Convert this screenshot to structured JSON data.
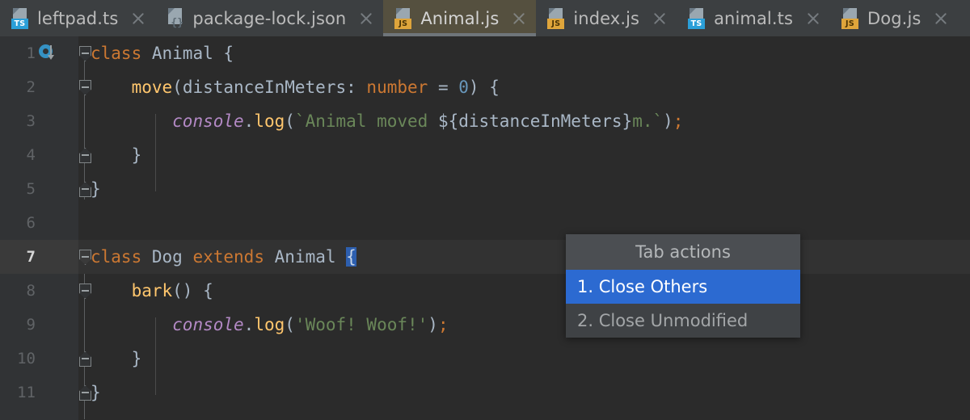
{
  "tabs": [
    {
      "label": "leftpad.ts",
      "icon": "typescript-file-icon",
      "badge": "TS",
      "kind": "ts",
      "active": false
    },
    {
      "label": "package-lock.json",
      "icon": "json-file-icon",
      "badge": "{}",
      "kind": "json",
      "active": false
    },
    {
      "label": "Animal.js",
      "icon": "javascript-file-icon",
      "badge": "JS",
      "kind": "js",
      "active": true
    },
    {
      "label": "index.js",
      "icon": "javascript-file-icon",
      "badge": "JS",
      "kind": "js",
      "active": false
    },
    {
      "label": "animal.ts",
      "icon": "typescript-file-icon",
      "badge": "TS",
      "kind": "ts",
      "active": false
    },
    {
      "label": "Dog.js",
      "icon": "javascript-file-icon",
      "badge": "JS",
      "kind": "js",
      "active": false
    }
  ],
  "editor": {
    "active_file": "Animal.js",
    "current_line": 7,
    "selection_text": "{",
    "line_numbers": [
      "1",
      "2",
      "3",
      "4",
      "5",
      "6",
      "7",
      "8",
      "9",
      "10",
      "11"
    ],
    "lines": [
      {
        "number": "1",
        "text": "class Animal {"
      },
      {
        "number": "2",
        "text": "    move(distanceInMeters: number = 0) {"
      },
      {
        "number": "3",
        "text": "        console.log(`Animal moved ${distanceInMeters}m.`);"
      },
      {
        "number": "4",
        "text": "    }"
      },
      {
        "number": "5",
        "text": "}"
      },
      {
        "number": "6",
        "text": ""
      },
      {
        "number": "7",
        "text": "class Dog extends Animal {"
      },
      {
        "number": "8",
        "text": "    bark() {"
      },
      {
        "number": "9",
        "text": "        console.log('Woof! Woof!');"
      },
      {
        "number": "10",
        "text": "    }"
      },
      {
        "number": "11",
        "text": "}"
      }
    ]
  },
  "popup": {
    "title": "Tab actions",
    "items": [
      {
        "label": "1. Close Others",
        "state": "selected"
      },
      {
        "label": "2. Close Unmodified",
        "state": "disabled"
      }
    ]
  },
  "colors": {
    "editor_background": "#2b2b2b",
    "gutter_background": "#313335",
    "tabbar_background": "#3c3f41",
    "active_tab_background": "#55503f",
    "keyword": "#cc7832",
    "function": "#ffc66d",
    "string": "#6a8759",
    "number": "#6897bb",
    "object": "#b389c5",
    "identifier": "#a9b7c6",
    "selection": "#2d5faf",
    "popup_highlight": "#2c6ad1"
  }
}
